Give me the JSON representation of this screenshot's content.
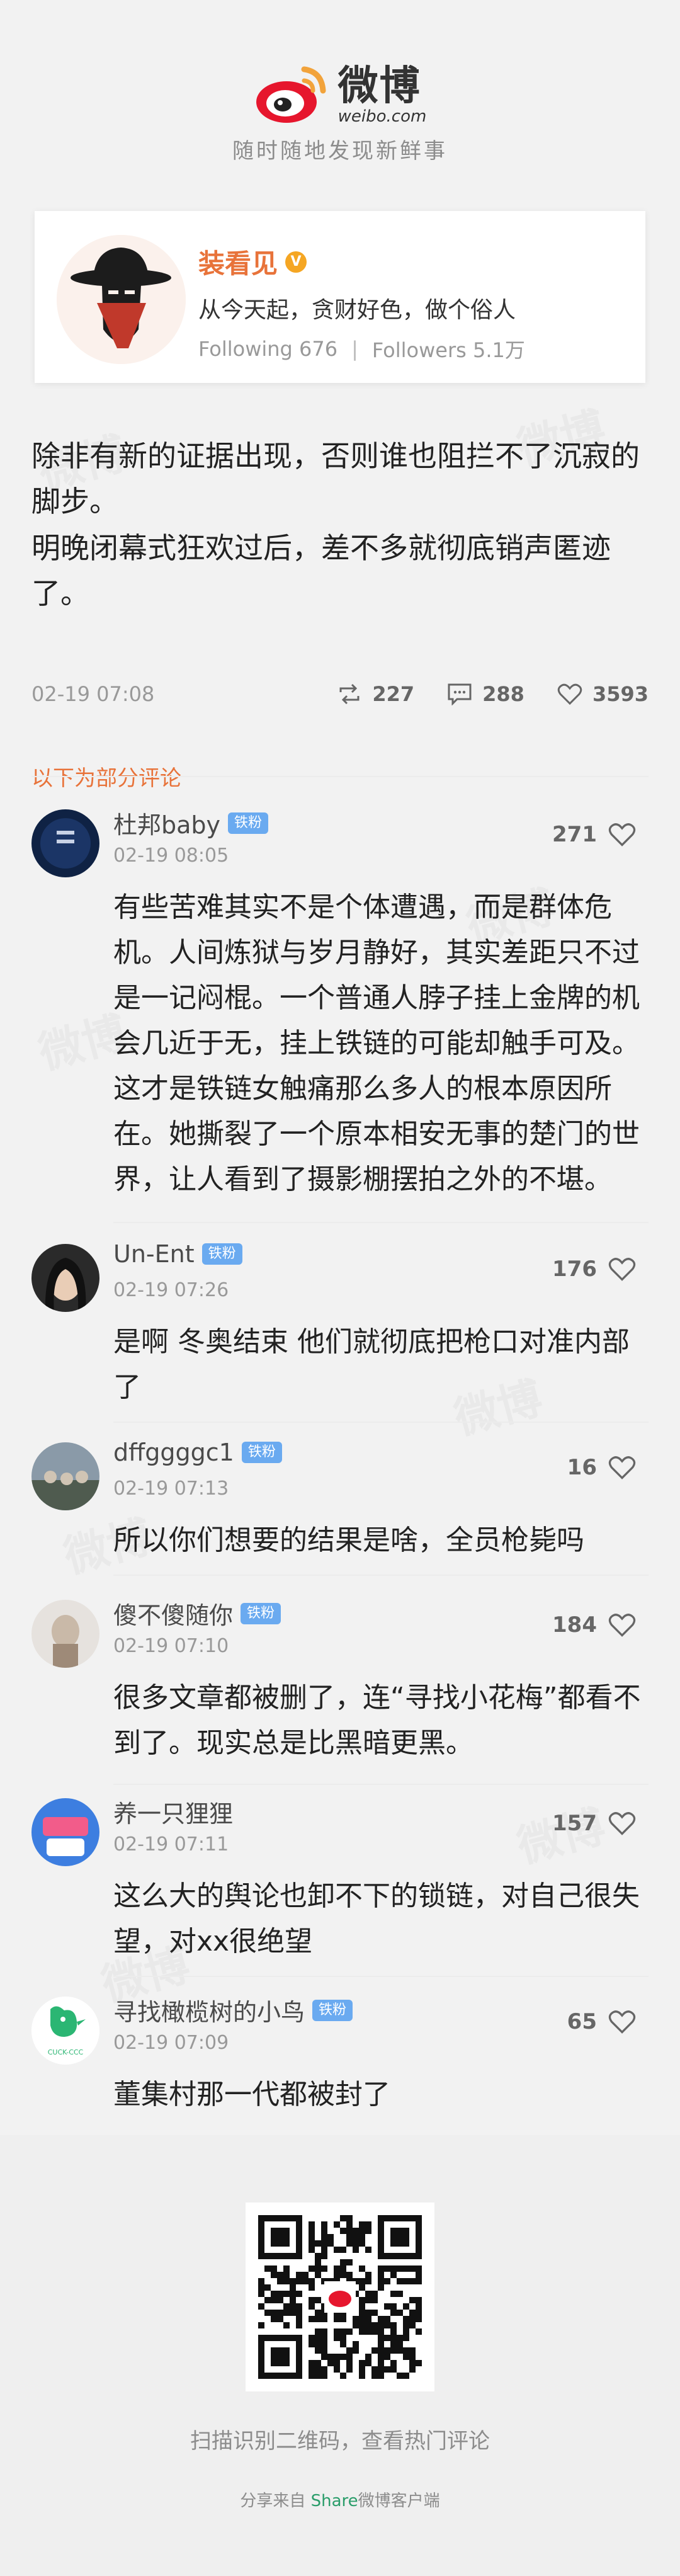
{
  "brand": {
    "logo_cn": "微博",
    "logo_en": "weibo.com",
    "slogan": "随时随地发现新鲜事"
  },
  "profile": {
    "name": "装看见",
    "bio": "从今天起，贪财好色，做个俗人",
    "following": "Following 676",
    "followers": "Followers 5.1万"
  },
  "post": {
    "paragraphs": [
      "除非有新的证据出现，否则谁也阻拦不了沉寂的脚步。",
      "明晚闭幕式狂欢过后，差不多就彻底销声匿迹了。"
    ],
    "time": "02-19 07:08",
    "reposts": "227",
    "comments": "288",
    "likes": "3593"
  },
  "comments_title": "以下为部分评论",
  "comments": [
    {
      "name": "杜邦baby",
      "badge": "铁粉",
      "time": "02-19 08:05",
      "likes": "271",
      "text": "有些苦难其实不是个体遭遇，而是群体危机。人间炼狱与岁月静好，其实差距只不过是一记闷棍。一个普通人脖子挂上金牌的机会几近于无，挂上铁链的可能却触手可及。这才是铁链女触痛那么多人的根本原因所在。她撕裂了一个原本相安无事的楚门的世界，让人看到了摄影棚摆拍之外的不堪。"
    },
    {
      "name": "Un-Ent",
      "badge": "铁粉",
      "time": "02-19 07:26",
      "likes": "176",
      "text": "是啊 冬奥结束 他们就彻底把枪口对准内部了"
    },
    {
      "name": "dffggggc1",
      "badge": "铁粉",
      "time": "02-19 07:13",
      "likes": "16",
      "text": "所以你们想要的结果是啥，全员枪毙吗"
    },
    {
      "name": "傻不傻随你",
      "badge": "铁粉",
      "time": "02-19 07:10",
      "likes": "184",
      "text": "很多文章都被删了，连“寻找小花梅”都看不到了。现实总是比黑暗更黑。"
    },
    {
      "name": "养一只狸狸",
      "badge": "",
      "time": "02-19 07:11",
      "likes": "157",
      "text": "这么大的舆论也卸不下的锁链，对自己很失望，对xx很绝望"
    },
    {
      "name": "寻找橄榄树的小鸟",
      "badge": "铁粉",
      "time": "02-19 07:09",
      "likes": "65",
      "text": "董集村那一代都被封了",
      "avatar_label": "CUCK-CCC"
    }
  ],
  "footer": {
    "qr_hint": "扫描识别二维码，查看热门评论",
    "share_prefix": "分享来自",
    "share_brand": "Share",
    "share_suffix": "微博客户端"
  },
  "colors": {
    "accent": "#e8733a",
    "badge": "#6aaaf0",
    "brand_green": "#2a9d6a"
  }
}
